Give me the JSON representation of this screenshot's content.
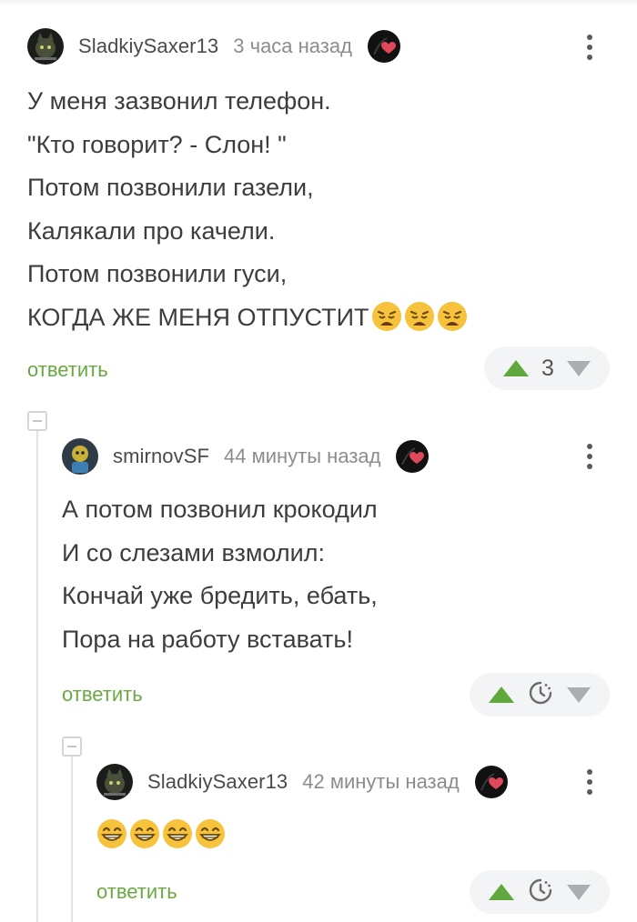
{
  "comments": [
    {
      "author": "SladkiySaxer13",
      "time": "3 часа назад",
      "lines": [
        "У меня зазвонил телефон.",
        "\"Кто говорит? - Слон! \"",
        "Потом позвонили газели,",
        "Калякали про качели.",
        "Потом позвонили гуси,",
        "КОГДА ЖЕ МЕНЯ ОТПУСТИТ"
      ],
      "trailing_emoji": [
        "weary-face",
        "weary-face",
        "weary-face"
      ],
      "reply_label": "ответить",
      "rating": "3"
    },
    {
      "author": "smirnovSF",
      "time": "44 минуты назад",
      "lines": [
        "А потом позвонил крокодил",
        "И со слезами взмолил:",
        "Кончай уже бредить, ебать,",
        "Пора на работу вставать!"
      ],
      "reply_label": "ответить",
      "rating_state": "timer"
    },
    {
      "author": "SladkiySaxer13",
      "time": "42 минуты назад",
      "emoji": [
        "grinning-face",
        "grinning-face",
        "grinning-face",
        "grinning-face"
      ],
      "reply_label": "ответить",
      "rating_state": "timer"
    }
  ],
  "colors": {
    "accent_green": "#6aa843",
    "upvote_green": "#5fa83c",
    "downvote_gray": "#a9aeb3",
    "text": "#3d3d3d",
    "muted": "#8c8c8c"
  },
  "icons": [
    "avatar-cat",
    "avatar-robot",
    "heart-badge-icon",
    "more-icon",
    "upvote-icon",
    "downvote-icon",
    "timer-icon",
    "collapse-icon"
  ]
}
